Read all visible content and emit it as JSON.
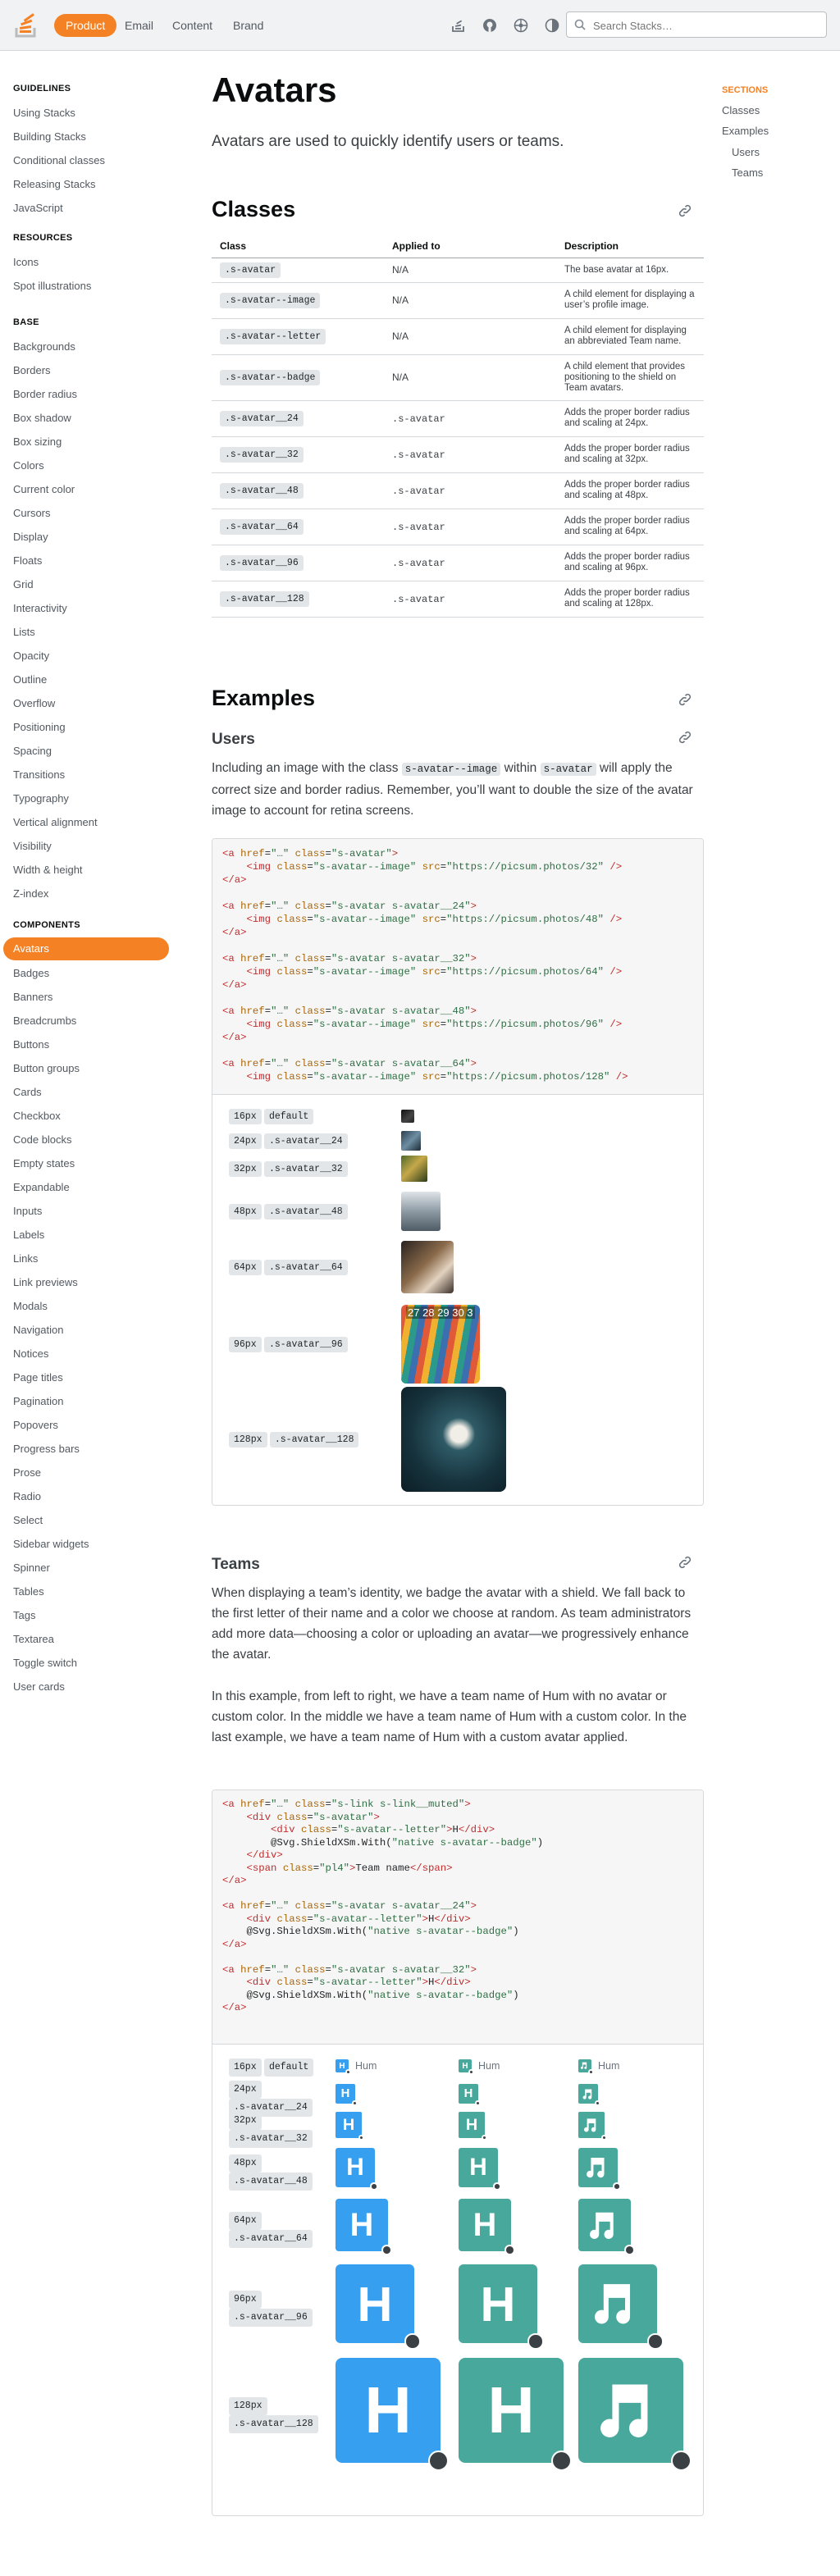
{
  "topbar": {
    "tabs": [
      "Product",
      "Email",
      "Content",
      "Brand"
    ],
    "search_placeholder": "Search Stacks…"
  },
  "sidebar": {
    "sections": [
      {
        "title": "GUIDELINES",
        "items": [
          "Using Stacks",
          "Building Stacks",
          "Conditional classes",
          "Releasing Stacks",
          "JavaScript"
        ]
      },
      {
        "title": "RESOURCES",
        "items": [
          "Icons",
          "Spot illustrations"
        ]
      },
      {
        "title": "BASE",
        "items": [
          "Backgrounds",
          "Borders",
          "Border radius",
          "Box shadow",
          "Box sizing",
          "Colors",
          "Current color",
          "Cursors",
          "Display",
          "Floats",
          "Grid",
          "Interactivity",
          "Lists",
          "Opacity",
          "Outline",
          "Overflow",
          "Positioning",
          "Spacing",
          "Transitions",
          "Typography",
          "Vertical alignment",
          "Visibility",
          "Width & height",
          "Z-index"
        ]
      },
      {
        "title": "COMPONENTS",
        "items": [
          "Avatars",
          "Badges",
          "Banners",
          "Breadcrumbs",
          "Buttons",
          "Button groups",
          "Cards",
          "Checkbox",
          "Code blocks",
          "Empty states",
          "Expandable",
          "Inputs",
          "Labels",
          "Links",
          "Link previews",
          "Modals",
          "Navigation",
          "Notices",
          "Page titles",
          "Pagination",
          "Popovers",
          "Progress bars",
          "Prose",
          "Radio",
          "Select",
          "Sidebar widgets",
          "Spinner",
          "Tables",
          "Tags",
          "Textarea",
          "Toggle switch",
          "User cards"
        ]
      }
    ],
    "active": "Avatars"
  },
  "toc": {
    "heading": "SECTIONS",
    "items": [
      "Classes",
      "Examples",
      "Users",
      "Teams"
    ]
  },
  "page": {
    "title": "Avatars",
    "lede": "Avatars are used to quickly identify users or teams."
  },
  "classes": {
    "heading": "Classes",
    "columns": [
      "Class",
      "Applied to",
      "Description"
    ],
    "rows": [
      {
        "cls": ".s-avatar",
        "applied": "N/A",
        "desc": "The base avatar at 16px."
      },
      {
        "cls": ".s-avatar--image",
        "applied": "N/A",
        "desc": "A child element for displaying a user’s profile image."
      },
      {
        "cls": ".s-avatar--letter",
        "applied": "N/A",
        "desc": "A child element for displaying an abbreviated Team name."
      },
      {
        "cls": ".s-avatar--badge",
        "applied": "N/A",
        "desc": "A child element that provides positioning to the shield on Team avatars."
      },
      {
        "cls": ".s-avatar__24",
        "applied": ".s-avatar",
        "desc": "Adds the proper border radius and scaling at 24px."
      },
      {
        "cls": ".s-avatar__32",
        "applied": ".s-avatar",
        "desc": "Adds the proper border radius and scaling at 32px."
      },
      {
        "cls": ".s-avatar__48",
        "applied": ".s-avatar",
        "desc": "Adds the proper border radius and scaling at 48px."
      },
      {
        "cls": ".s-avatar__64",
        "applied": ".s-avatar",
        "desc": "Adds the proper border radius and scaling at 64px."
      },
      {
        "cls": ".s-avatar__96",
        "applied": ".s-avatar",
        "desc": "Adds the proper border radius and scaling at 96px."
      },
      {
        "cls": ".s-avatar__128",
        "applied": ".s-avatar",
        "desc": "Adds the proper border radius and scaling at 128px."
      }
    ]
  },
  "examples": {
    "heading": "Examples",
    "users": {
      "heading": "Users",
      "para_a": "Including an image with the class",
      "code_a": "s-avatar--image",
      "para_b": "within",
      "code_b": "s-avatar",
      "para_c": "will apply the correct size and border radius. Remember, you’ll want to double the size of the avatar image to account for retina screens.",
      "demo_rows": [
        {
          "size": "16px",
          "cls": "default"
        },
        {
          "size": "24px",
          "cls": ".s-avatar__24"
        },
        {
          "size": "32px",
          "cls": ".s-avatar__32"
        },
        {
          "size": "48px",
          "cls": ".s-avatar__48"
        },
        {
          "size": "64px",
          "cls": ".s-avatar__64"
        },
        {
          "size": "96px",
          "cls": ".s-avatar__96"
        },
        {
          "size": "128px",
          "cls": ".s-avatar__128"
        }
      ],
      "image_text": "27 28 29 30 3"
    },
    "teams": {
      "heading": "Teams",
      "para1": "When displaying a team’s identity, we badge the avatar with a shield. We fall back to the first letter of their name and a color we choose at random. As team administrators add more data—choosing a color or uploading an avatar—we progressively enhance the avatar.",
      "para2": "In this example, from left to right, we have a team name of Hum with no avatar or custom color. In the middle we have a team name of Hum with a custom color. In the last example, we have a team name of Hum with a custom avatar applied.",
      "team_name": "Hum",
      "letter": "H",
      "demo_rows": [
        {
          "size": "16px",
          "cls": "default"
        },
        {
          "size": "24px",
          "cls": ".s-avatar__24"
        },
        {
          "size": "32px",
          "cls": ".s-avatar__32"
        },
        {
          "size": "48px",
          "cls": ".s-avatar__48"
        },
        {
          "size": "64px",
          "cls": ".s-avatar__64"
        },
        {
          "size": "96px",
          "cls": ".s-avatar__96"
        },
        {
          "size": "128px",
          "cls": ".s-avatar__128"
        }
      ]
    }
  },
  "colors": {
    "accent": "#f48225",
    "team_blue": "#379fef",
    "team_teal": "#48a89b",
    "shield": "#3b4045"
  }
}
